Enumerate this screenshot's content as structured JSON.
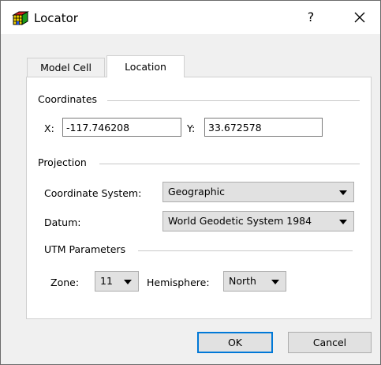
{
  "window": {
    "title": "Locator",
    "help_label": "?",
    "close_label": "close"
  },
  "tabs": [
    {
      "label": "Model Cell",
      "active": false
    },
    {
      "label": "Location",
      "active": true
    }
  ],
  "coordinates": {
    "group_label": "Coordinates",
    "x_label": "X:",
    "x_value": "-117.746208",
    "y_label": "Y:",
    "y_value": "33.672578"
  },
  "projection": {
    "group_label": "Projection",
    "coord_system_label": "Coordinate System:",
    "coord_system_value": "Geographic",
    "datum_label": "Datum:",
    "datum_value": "World Geodetic System 1984"
  },
  "utm": {
    "group_label": "UTM Parameters",
    "zone_label": "Zone:",
    "zone_value": "11",
    "hemisphere_label": "Hemisphere:",
    "hemisphere_value": "North"
  },
  "buttons": {
    "ok": "OK",
    "cancel": "Cancel"
  },
  "colors": {
    "accent": "#0078d7",
    "window_bg": "#f0f0f0",
    "panel_bg": "#ffffff"
  }
}
